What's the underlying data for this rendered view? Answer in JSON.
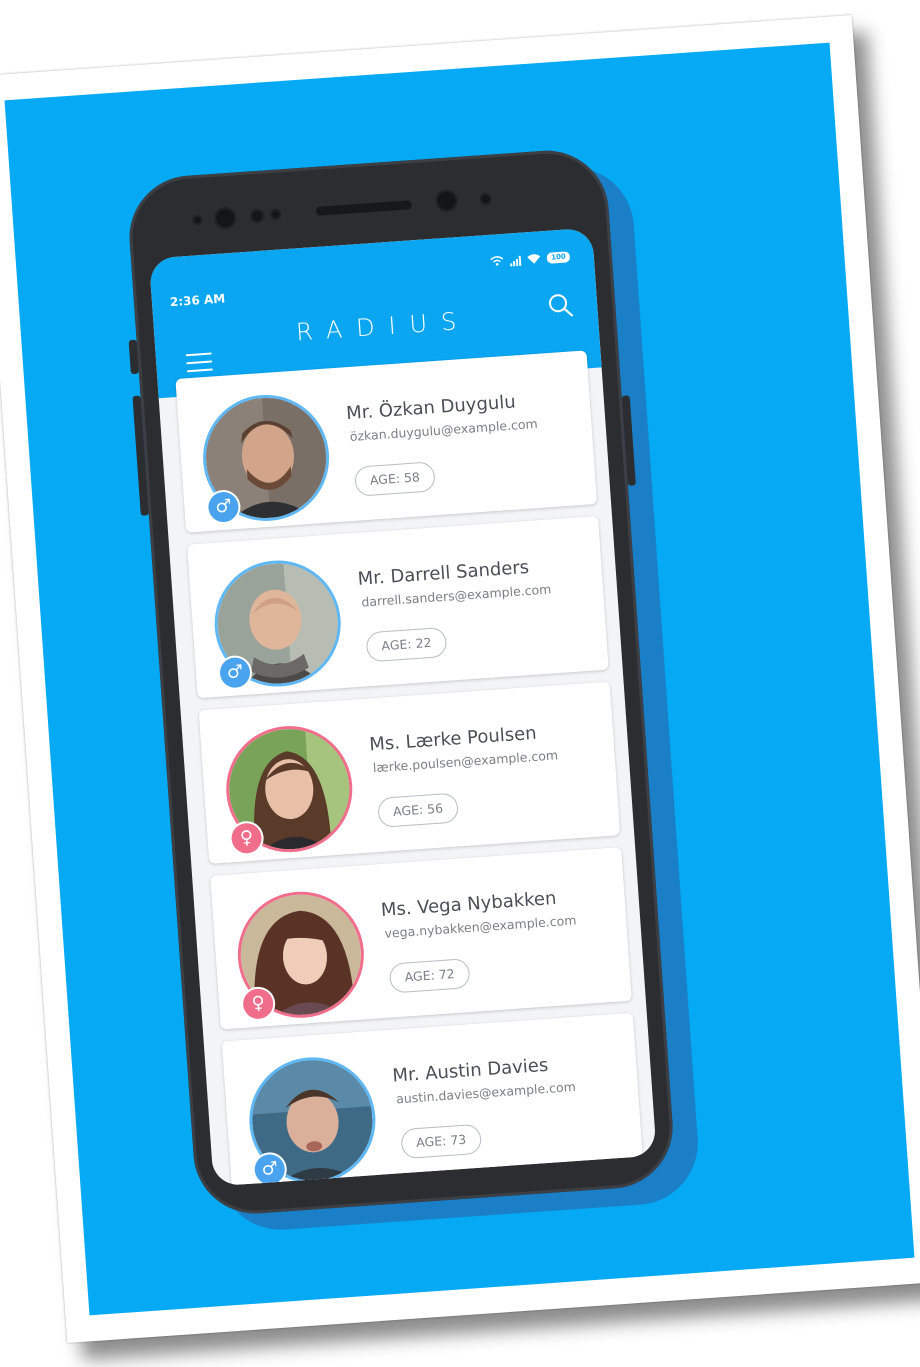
{
  "status": {
    "time": "2:36 AM",
    "battery": "100"
  },
  "app": {
    "title": "RADIUS"
  },
  "users": [
    {
      "name": "Mr. Özkan Duygulu",
      "email": "özkan.duygulu@example.com",
      "age": "AGE: 58",
      "gender": "male",
      "gender_symbol": "♂"
    },
    {
      "name": "Mr. Darrell Sanders",
      "email": "darrell.sanders@example.com",
      "age": "AGE: 22",
      "gender": "male",
      "gender_symbol": "♂"
    },
    {
      "name": "Ms. Lærke Poulsen",
      "email": "lærke.poulsen@example.com",
      "age": "AGE: 56",
      "gender": "female",
      "gender_symbol": "♀"
    },
    {
      "name": "Ms. Vega Nybakken",
      "email": "vega.nybakken@example.com",
      "age": "AGE: 72",
      "gender": "female",
      "gender_symbol": "♀"
    },
    {
      "name": "Mr. Austin Davies",
      "email": "austin.davies@example.com",
      "age": "AGE: 73",
      "gender": "male",
      "gender_symbol": "♂"
    }
  ],
  "colors": {
    "poster": "#06a9f4",
    "appbar": "#0aa6f2",
    "male": "#4aa3ef",
    "female": "#f06d8c"
  }
}
